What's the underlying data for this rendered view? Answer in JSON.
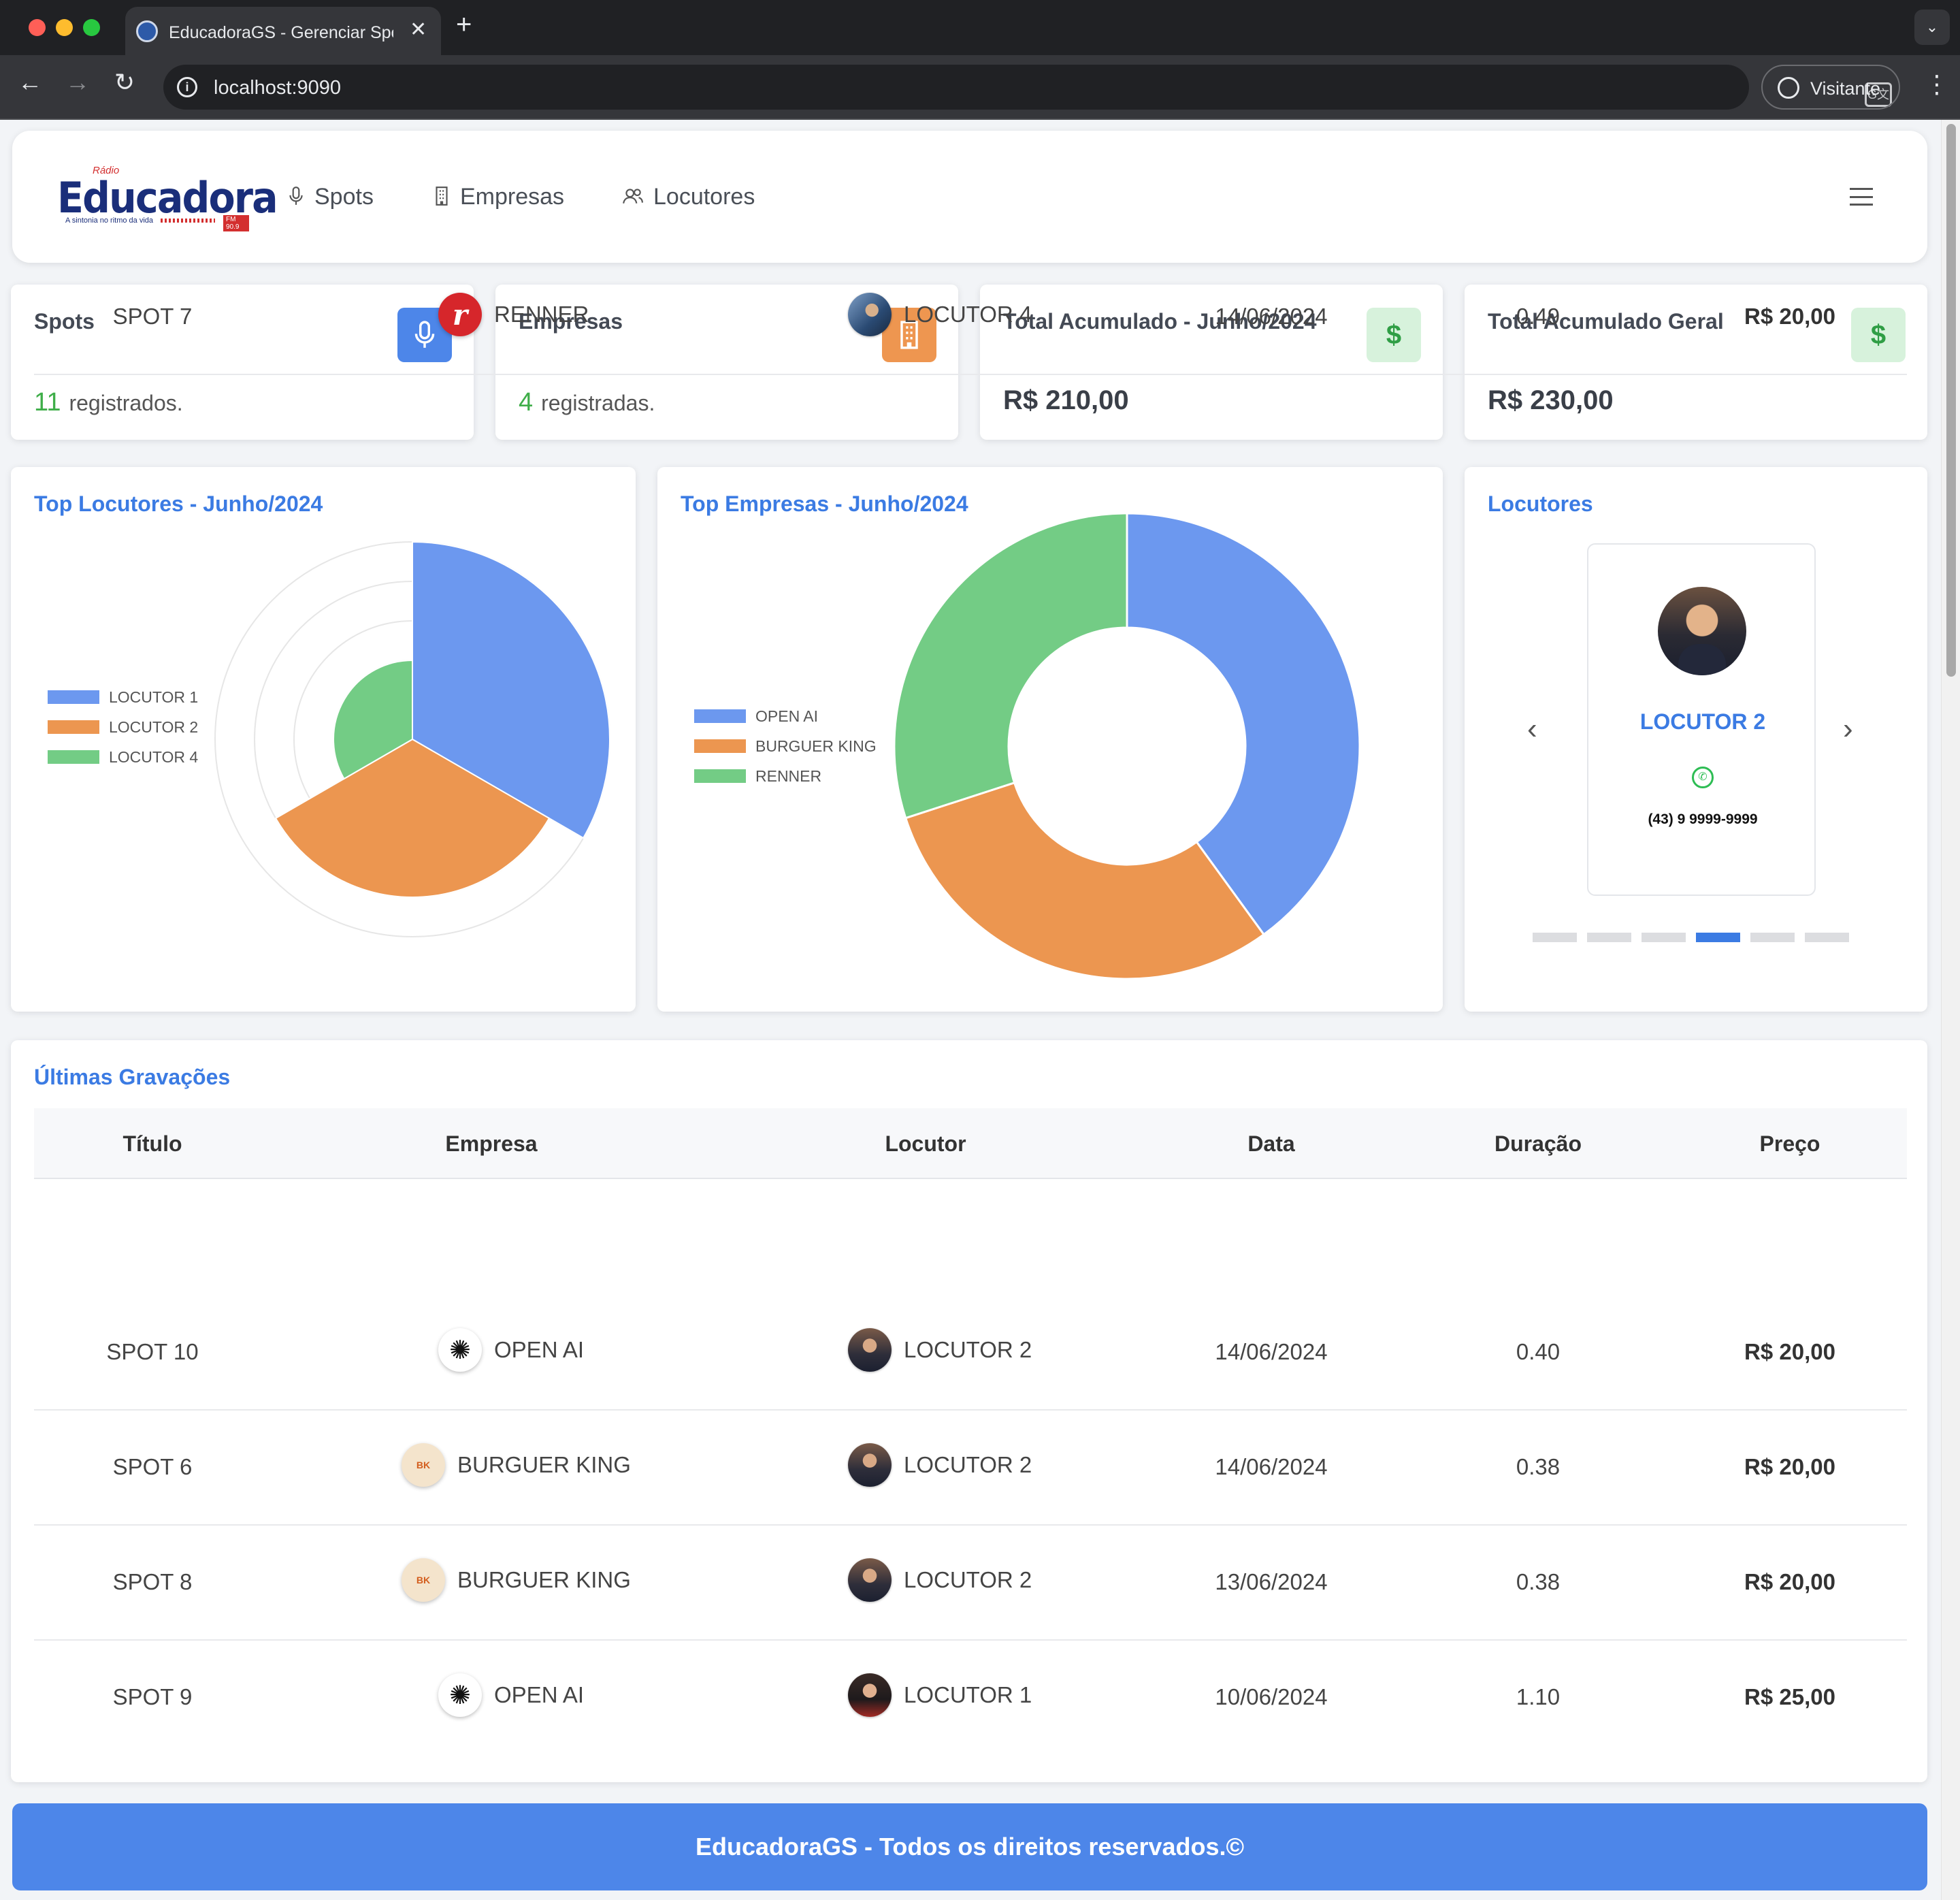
{
  "browser": {
    "tab_title": "EducadoraGS - Gerenciar Spots",
    "url": "localhost:9090",
    "profile_label": "Visitante",
    "traffic_colors": [
      "#ff5f57",
      "#febc2e",
      "#28c840"
    ]
  },
  "navbar": {
    "logo_small": "Rádio",
    "logo_main": "Educadora",
    "logo_tagline": "A sintonia no ritmo da vida",
    "logo_fm": "FM 90.9",
    "items": [
      {
        "label": "Spots",
        "icon": "microphone-icon"
      },
      {
        "label": "Empresas",
        "icon": "building-icon"
      },
      {
        "label": "Locutores",
        "icon": "users-icon"
      }
    ]
  },
  "stats": [
    {
      "title": "Spots",
      "count": "11",
      "suffix": "registrados.",
      "icon": "microphone-icon",
      "icon_color": "#4d86e9"
    },
    {
      "title": "Empresas",
      "count": "4",
      "suffix": "registradas.",
      "icon": "building-icon",
      "icon_color": "#ee9650"
    },
    {
      "title": "Total Acumulado - Junho/2024",
      "value": "R$ 210,00",
      "icon": "dollar-icon",
      "icon_color": "#d7f2dc"
    },
    {
      "title": "Total Acumulado Geral",
      "value": "R$ 230,00",
      "icon": "dollar-icon",
      "icon_color": "#d7f2dc"
    }
  ],
  "chart_data": [
    {
      "type": "polar-area",
      "title": "Top Locutores - Junho/2024",
      "legend_position": "left",
      "categories": [
        "LOCUTOR 1",
        "LOCUTOR 2",
        "LOCUTOR 4"
      ],
      "values": [
        25,
        20,
        10
      ],
      "r_max": 25,
      "colors": [
        "#6c98ef",
        "#ec9650",
        "#73cc85"
      ]
    },
    {
      "type": "doughnut",
      "title": "Top Empresas - Junho/2024",
      "legend_position": "left",
      "categories": [
        "OPEN AI",
        "BURGUER KING",
        "RENNER"
      ],
      "values": [
        40,
        30,
        30
      ],
      "colors": [
        "#6c98ef",
        "#ec9650",
        "#73cc85"
      ]
    }
  ],
  "locutores_carousel": {
    "title": "Locutores",
    "current_name": "LOCUTOR 2",
    "current_phone": "(43) 9 9999-9999",
    "slide_count": 6,
    "active_index": 3
  },
  "recordings": {
    "title": "Últimas Gravações",
    "columns": [
      "Título",
      "Empresa",
      "Locutor",
      "Data",
      "Duração",
      "Preço"
    ],
    "rows": [
      {
        "titulo": "SPOT 7",
        "empresa": "RENNER",
        "empresa_logo": "renner-logo",
        "locutor": "LOCUTOR 4",
        "data": "14/06/2024",
        "duracao": "0.49",
        "preco": "R$ 20,00"
      },
      {
        "titulo": "SPOT 10",
        "empresa": "OPEN AI",
        "empresa_logo": "openai-logo",
        "locutor": "LOCUTOR 2",
        "data": "14/06/2024",
        "duracao": "0.40",
        "preco": "R$ 20,00"
      },
      {
        "titulo": "SPOT 6",
        "empresa": "BURGUER KING",
        "empresa_logo": "burger-king-logo",
        "locutor": "LOCUTOR 2",
        "data": "14/06/2024",
        "duracao": "0.38",
        "preco": "R$ 20,00"
      },
      {
        "titulo": "SPOT 8",
        "empresa": "BURGUER KING",
        "empresa_logo": "burger-king-logo",
        "locutor": "LOCUTOR 2",
        "data": "13/06/2024",
        "duracao": "0.38",
        "preco": "R$ 20,00"
      },
      {
        "titulo": "SPOT 9",
        "empresa": "OPEN AI",
        "empresa_logo": "openai-logo",
        "locutor": "LOCUTOR 1",
        "data": "10/06/2024",
        "duracao": "1.10",
        "preco": "R$ 25,00"
      }
    ]
  },
  "footer": {
    "text": "EducadoraGS - Todos os direitos reservados.©"
  }
}
